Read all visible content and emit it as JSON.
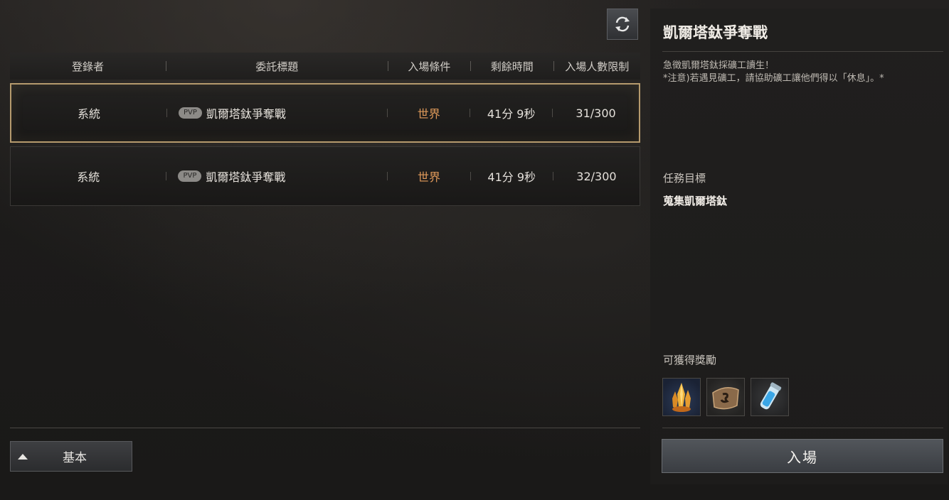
{
  "table": {
    "headers": [
      "登錄者",
      "委託標題",
      "入場條件",
      "剩餘時間",
      "入場人數限制"
    ],
    "rows": [
      {
        "registrant": "系統",
        "tag": "PVP",
        "title": "凱爾塔鈦爭奪戰",
        "condition": "世界",
        "time": "41分 9秒",
        "limit": "31/300",
        "selected": true
      },
      {
        "registrant": "系統",
        "tag": "PVP",
        "title": "凱爾塔鈦爭奪戰",
        "condition": "世界",
        "time": "41分 9秒",
        "limit": "32/300",
        "selected": false
      }
    ]
  },
  "footer": {
    "mode_label": "基本"
  },
  "panel": {
    "title": "凱爾塔鈦爭奪戰",
    "desc_line1": "急徵凱爾塔鈦採礦工讀生！",
    "desc_line2": "*注意)若遇見礦工，請協助礦工讓他們得以「休息」。*",
    "goal_heading": "任務目標",
    "goal_text": "蒐集凱爾塔鈦",
    "reward_heading": "可獲得獎勵",
    "rewards": [
      "crystal-cluster-icon",
      "leather-pouch-icon",
      "potion-vial-icon"
    ],
    "enter_label": "入場"
  },
  "colors": {
    "accent_border": "#b59a6d",
    "condition_text": "#e09a5a"
  }
}
